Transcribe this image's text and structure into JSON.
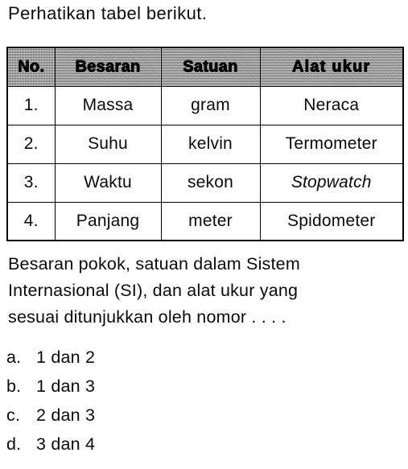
{
  "intro": {
    "text": "Perhatikan tabel berikut."
  },
  "table": {
    "headers": [
      "No.",
      "Besaran",
      "Satuan",
      "Alat ukur"
    ],
    "rows": [
      {
        "no": "1.",
        "besaran": "Massa",
        "satuan": "gram",
        "alat": "Neraca",
        "alat_italic": false
      },
      {
        "no": "2.",
        "besaran": "Suhu",
        "satuan": "kelvin",
        "alat": "Termometer",
        "alat_italic": false
      },
      {
        "no": "3.",
        "besaran": "Waktu",
        "satuan": "sekon",
        "alat": "Stopwatch",
        "alat_italic": true
      },
      {
        "no": "4.",
        "besaran": "Panjang",
        "satuan": "meter",
        "alat": "Spidometer",
        "alat_italic": false
      }
    ]
  },
  "question": {
    "line1": "Besaran pokok, satuan dalam Sistem",
    "line2": "Internasional (SI), dan alat ukur yang",
    "line3": "sesuai ditunjukkan oleh nomor . . . ."
  },
  "options": [
    {
      "letter": "a.",
      "text": "1 dan 2"
    },
    {
      "letter": "b.",
      "text": "1 dan 3"
    },
    {
      "letter": "c.",
      "text": "2 dan 3"
    },
    {
      "letter": "d.",
      "text": "3 dan 4"
    }
  ],
  "colors": {
    "text": "#0a0a0a",
    "page_background": "#ffffff",
    "header_background": "#9c9c9c",
    "border": "#000000"
  }
}
